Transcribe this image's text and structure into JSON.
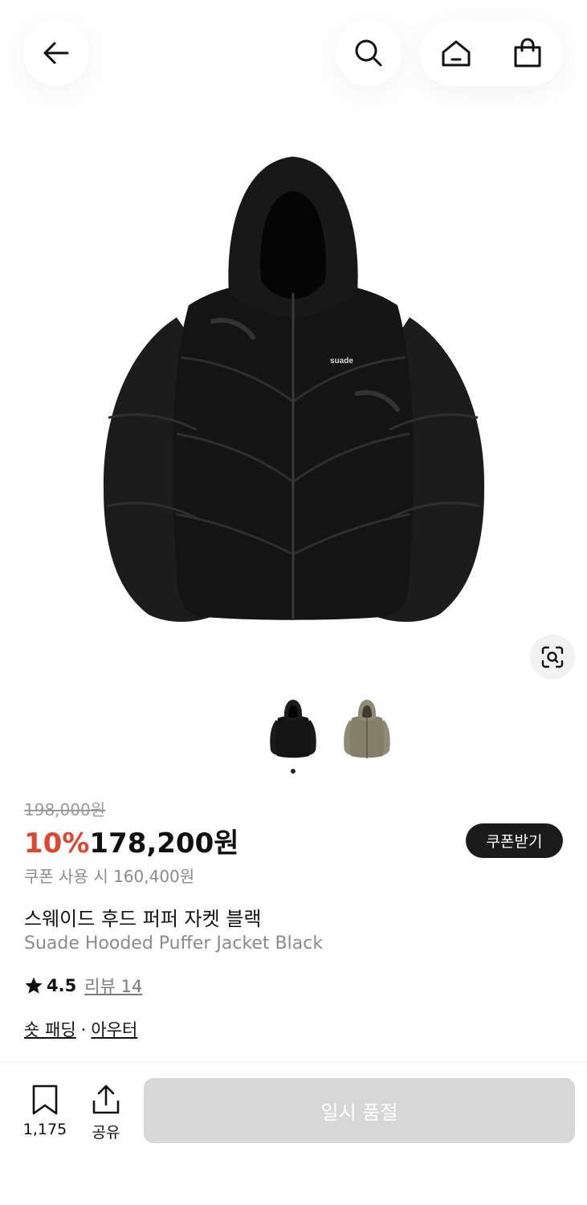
{
  "header": {
    "back_icon": "arrow-left-icon",
    "search_icon": "search-icon",
    "home_icon": "home-icon",
    "cart_icon": "shopping-bag-icon"
  },
  "hero": {
    "image_label": "suade",
    "lens_icon": "image-search-icon"
  },
  "thumbnails": {
    "count": 2,
    "selected_index": 0,
    "colors": [
      "#1a1a1a",
      "#8e8a74"
    ]
  },
  "price": {
    "original": "198,000원",
    "discount": "10%",
    "sale": "178,200원",
    "coupon_button": "쿠폰받기",
    "coupon_price": "쿠폰 사용 시 160,400원",
    "discount_color": "#e0452f"
  },
  "product": {
    "title_ko": "스웨이드 후드 퍼퍼 자켓 블랙",
    "title_en": "Suade Hooded Puffer Jacket Black"
  },
  "rating": {
    "star_icon": "star-icon",
    "value": "4.5",
    "review_label": "리뷰 14"
  },
  "categories": {
    "items": [
      "숏 패딩",
      "아우터"
    ],
    "separator": "·"
  },
  "bottom_bar": {
    "save_count": "1,175",
    "share_label": "공유",
    "soldout_label": "일시 품절"
  }
}
